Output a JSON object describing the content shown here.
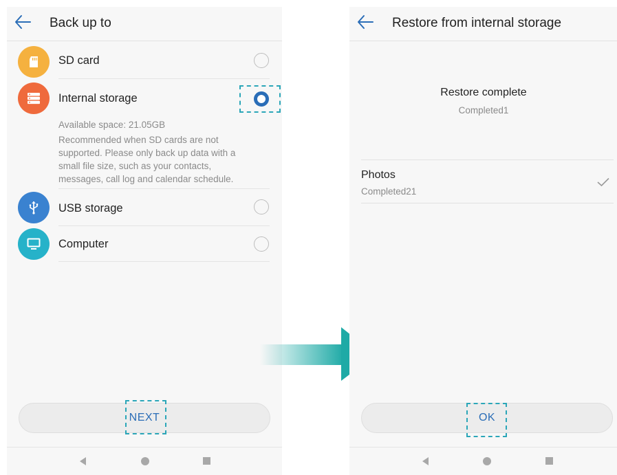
{
  "left_screen": {
    "title": "Back up to",
    "options": [
      {
        "label": "SD card",
        "icon": "sd-card-icon",
        "color": "#f5b13f",
        "selected": false
      },
      {
        "label": "Internal storage",
        "icon": "storage-icon",
        "color": "#ef6a3c",
        "selected": true
      },
      {
        "label": "USB storage",
        "icon": "usb-icon",
        "color": "#3a82d0",
        "selected": false
      },
      {
        "label": "Computer",
        "icon": "monitor-icon",
        "color": "#26b2c9",
        "selected": false
      }
    ],
    "available_space": "Available space: 21.05GB",
    "description": "Recommended when SD cards are not supported. Please only back up data with a small file size, such as your contacts, messages, call log and calendar schedule.",
    "next_button": "NEXT"
  },
  "right_screen": {
    "title": "Restore from internal storage",
    "status_title": "Restore complete",
    "status_subtitle": "Completed1",
    "items": [
      {
        "name": "Photos",
        "status": "Completed21",
        "done": true
      }
    ],
    "ok_button": "OK"
  },
  "colors": {
    "accent_blue": "#2a6db7",
    "highlight_teal": "#2aa6b8",
    "arrow_teal": "#1eaaa6"
  }
}
